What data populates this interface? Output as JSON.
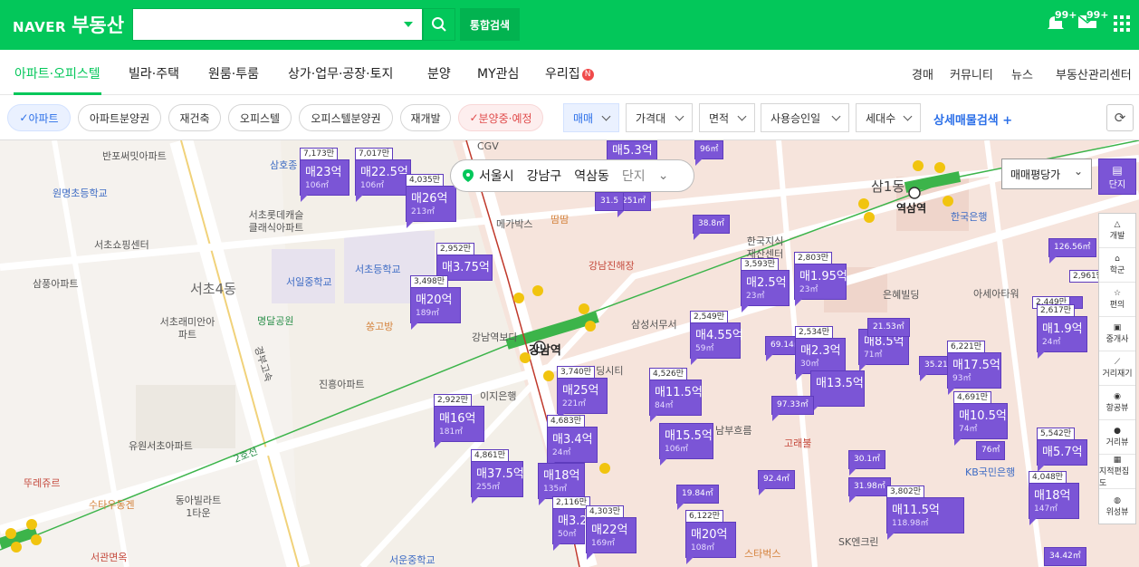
{
  "header": {
    "logo_naver": "NAVER",
    "logo_service": "부동산",
    "search_placeholder": "",
    "integrated_search": "통합검색",
    "notif_count": "99+",
    "mail_count": "99+"
  },
  "nav": {
    "items": [
      "아파트·오피스텔",
      "빌라·주택",
      "원룸·투룸",
      "상가·업무·공장·토지",
      "분양",
      "MY관심",
      "우리집"
    ],
    "new_badge": "N",
    "right": [
      "경매",
      "커뮤니티",
      "뉴스",
      "부동산관리센터"
    ]
  },
  "filters": {
    "chips": [
      "아파트",
      "아파트분양권",
      "재건축",
      "오피스텔",
      "오피스텔분양권",
      "재개발",
      "분양중·예정"
    ],
    "dropdowns": [
      "매매",
      "가격대",
      "면적",
      "사용승인일",
      "세대수"
    ],
    "detail": "상세매물검색 +"
  },
  "location": {
    "city": "서울시",
    "district": "강남구",
    "dong": "역삼동",
    "danji": "단지"
  },
  "price_type": "매매평당가",
  "right_tools": {
    "danji": "단지",
    "items": [
      "개발",
      "학군",
      "편의",
      "중개사",
      "거리재기",
      "항공뷰",
      "거리뷰",
      "지적편집도",
      "위성뷰"
    ]
  },
  "map_labels": {
    "stations": [
      "강남역",
      "역삼역"
    ],
    "areas": [
      "서초4동",
      "삼1동"
    ],
    "places": [
      "반포써밋아파트",
      "원명초등학교",
      "서초쇼핑센터",
      "서초롯데캐슬클래식아파트",
      "삼풍아파트",
      "서일중학교",
      "서초등학교",
      "서초래미안아파트",
      "명달공원",
      "진흥아파트",
      "유원서초아파트",
      "뚜레쥬르",
      "수타우동겐",
      "동아빌라트1타운",
      "서관면옥",
      "서운중학교",
      "CGV",
      "메가박스",
      "땀땀",
      "강남진해장",
      "삼성서무서",
      "한국지식재산센터",
      "은혜빌딩",
      "아세아타워",
      "한국은행",
      "고래불",
      "스타벅스",
      "KB국민은행",
      "SK엔크린",
      "이지은행",
      "삼호종",
      "강남역보다",
      "경부고속",
      "2호선",
      "쏭고방",
      "남부흐름",
      "빌딩시티"
    ]
  },
  "listings": [
    {
      "top": "7,173만",
      "price": "매23억",
      "area": "106㎡"
    },
    {
      "top": "7,017만",
      "price": "매22.5억",
      "area": "106㎡"
    },
    {
      "top": "4,035만",
      "price": "매26억",
      "area": "213㎡"
    },
    {
      "top": "2,952만",
      "price": "매3.75억",
      "area": ""
    },
    {
      "top": "3,498만",
      "price": "매20억",
      "area": "189㎡"
    },
    {
      "top": "",
      "price": "매5.3억",
      "area": ""
    },
    {
      "top": "",
      "price": "",
      "area": "96㎡"
    },
    {
      "top": "",
      "price": "",
      "area": "251㎡"
    },
    {
      "top": "",
      "price": "",
      "area": "31.5"
    },
    {
      "top": "",
      "price": "",
      "area": "38.8㎡"
    },
    {
      "top": "3,593만",
      "price": "매2.5억",
      "area": "23㎡"
    },
    {
      "top": "2,803만",
      "price": "매1.95억",
      "area": "23㎡"
    },
    {
      "top": "2,549만",
      "price": "매4.55억",
      "area": "59㎡"
    },
    {
      "top": "2,534만",
      "price": "매2.3억",
      "area": "30㎡"
    },
    {
      "top": "",
      "price": "매13.5억",
      "area": ""
    },
    {
      "top": "",
      "price": "",
      "area": "69.14㎡"
    },
    {
      "top": "",
      "price": "",
      "area": "21.53㎡"
    },
    {
      "top": "",
      "price": "매8.5억",
      "area": "71㎡"
    },
    {
      "top": "6,221만",
      "price": "매17.5억",
      "area": "93㎡"
    },
    {
      "top": "",
      "price": "",
      "area": "35.21㎡"
    },
    {
      "top": "3,740만",
      "price": "매25억",
      "area": "221㎡"
    },
    {
      "top": "4,526만",
      "price": "매11.5억",
      "area": "84㎡"
    },
    {
      "top": "2,922만",
      "price": "매16억",
      "area": "181㎡"
    },
    {
      "top": "4,683만",
      "price": "매3.4억",
      "area": "24㎡"
    },
    {
      "top": "",
      "price": "매15.5억",
      "area": "106㎡"
    },
    {
      "top": "",
      "price": "",
      "area": "97.33㎡"
    },
    {
      "top": "4,691만",
      "price": "매10.5억",
      "area": "74㎡"
    },
    {
      "top": "4,861만",
      "price": "매37.5억",
      "area": "255㎡"
    },
    {
      "top": "",
      "price": "매18억",
      "area": "135㎡"
    },
    {
      "top": "2,116만",
      "price": "매3.2",
      "area": "50㎡"
    },
    {
      "top": "4,303만",
      "price": "매22억",
      "area": "169㎡"
    },
    {
      "top": "5,542만",
      "price": "매5.7억",
      "area": ""
    },
    {
      "top": "4,048만",
      "price": "매18억",
      "area": "147㎡"
    },
    {
      "top": "3,802만",
      "price": "매11.5억",
      "area": "118.98㎡"
    },
    {
      "top": "6,122만",
      "price": "매20억",
      "area": "108㎡"
    },
    {
      "top": "",
      "price": "",
      "area": "19.84㎡"
    },
    {
      "top": "",
      "price": "",
      "area": "92.4㎡"
    },
    {
      "top": "",
      "price": "",
      "area": "30.1㎡"
    },
    {
      "top": "",
      "price": "",
      "area": "31.98㎡"
    },
    {
      "top": "2,449만",
      "price": "",
      "area": ""
    },
    {
      "top": "2,617만",
      "price": "매1.9억",
      "area": "24㎡"
    },
    {
      "top": "2,961만",
      "price": "",
      "area": ""
    },
    {
      "top": "",
      "price": "",
      "area": "126.56㎡"
    },
    {
      "top": "",
      "price": "",
      "area": "34.42㎡"
    },
    {
      "top": "",
      "price": "",
      "area": "76㎡"
    }
  ]
}
